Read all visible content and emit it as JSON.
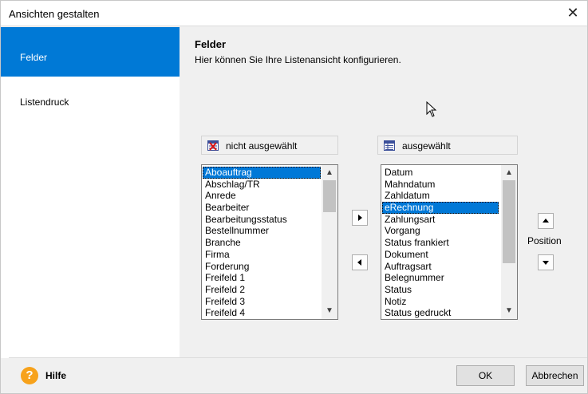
{
  "window": {
    "title": "Ansichten gestalten",
    "close_glyph": "✕"
  },
  "sidebar": {
    "items": [
      {
        "label": "Felder"
      },
      {
        "label": "Listendruck"
      }
    ]
  },
  "header": {
    "title": "Felder",
    "subtitle": "Hier können Sie Ihre Listenansicht konfigurieren."
  },
  "lists": {
    "available": {
      "title": "nicht ausgewählt",
      "icon": "list-not-selected-icon",
      "items": [
        "Aboauftrag",
        "Abschlag/TR",
        "Anrede",
        "Bearbeiter",
        "Bearbeitungsstatus",
        "Bestellnummer",
        "Branche",
        "Firma",
        "Forderung",
        "Freifeld 1",
        "Freifeld 2",
        "Freifeld 3",
        "Freifeld 4"
      ],
      "selected": "Aboauftrag"
    },
    "chosen": {
      "title": "ausgewählt",
      "icon": "list-selected-icon",
      "items": [
        "Datum",
        "Mahndatum",
        "Zahldatum",
        "eRechnung",
        "Zahlungsart",
        "Vorgang",
        "Status frankiert",
        "Dokument",
        "Auftragsart",
        "Belegnummer",
        "Status",
        "Notiz",
        "Status gedruckt"
      ],
      "selected": "eRechnung"
    }
  },
  "position_label": "Position",
  "footer": {
    "help_glyph": "?",
    "help_label": "Hilfe",
    "ok_label": "OK",
    "cancel_label": "Abbrechen"
  },
  "colors": {
    "accent": "#0079d6",
    "selection": "#0078d7",
    "help": "#f7a21b"
  }
}
